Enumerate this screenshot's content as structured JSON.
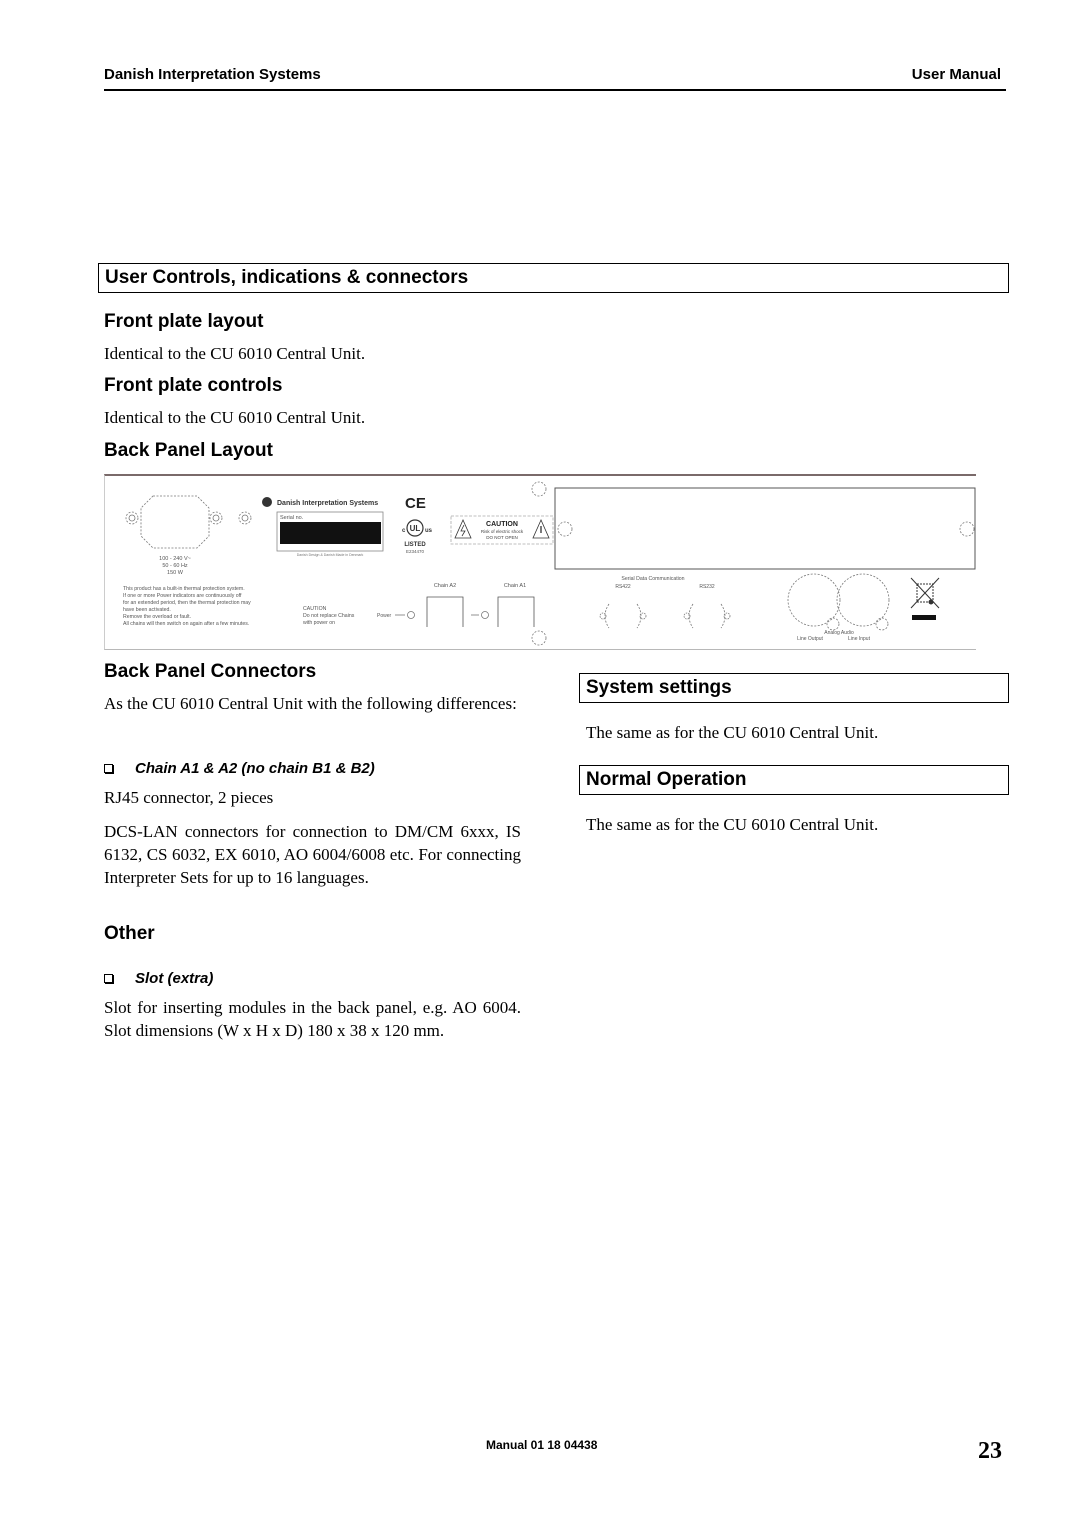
{
  "header": {
    "company": "Danish Interpretation Systems",
    "doc_type": "User Manual"
  },
  "section_title": "User Controls, indications & connectors",
  "left_column": {
    "front_plate_layout": {
      "heading": "Front plate layout",
      "text": "Identical to the CU 6010 Central Unit."
    },
    "front_plate_controls": {
      "heading": "Front plate controls",
      "text": "Identical to the CU 6010 Central Unit."
    },
    "back_panel_layout": {
      "heading": "Back Panel Layout"
    },
    "back_panel_connectors": {
      "heading": "Back Panel Connectors",
      "intro": "As the CU 6010 Central Unit with the following differences:",
      "bullet": "Chain A1 & A2 (no chain B1 & B2)",
      "bullet_text1": "RJ45 connector, 2 pieces",
      "bullet_text2": "DCS-LAN connectors for connection to DM/CM 6xxx, IS 6132, CS 6032, EX 6010, AO 6004/6008 etc. For connecting Interpreter Sets for up to 16 languages."
    },
    "other": {
      "heading": "Other",
      "bullet": "Slot (extra)",
      "text": "Slot for inserting modules in the back panel, e.g. AO 6004. Slot dimensions (W x H x D) 180 x 38 x 120 mm."
    }
  },
  "right_column": {
    "system_settings": {
      "heading": "System settings",
      "text": "The same as for the CU 6010 Central Unit."
    },
    "normal_operation": {
      "heading": "Normal Operation",
      "text": "The same as for the CU 6010 Central Unit."
    }
  },
  "back_panel_figure": {
    "brand": "Danish Interpretation Systems",
    "serial_label": "Serial no.",
    "serial_caption": "Danish Design & Danish Made in Denmark",
    "ce_mark": "CE",
    "ul_listed": "LISTED",
    "ul_number": "E234470",
    "ul_left": "c",
    "ul_right": "us",
    "caution_title": "CAUTION",
    "caution_line1": "Risk of electric shock",
    "caution_line2": "DO NOT OPEN",
    "power_rating": [
      "100 - 240 V~",
      "50 - 60 Hz",
      "150 W"
    ],
    "thermal_notice": [
      "This product has a built-in thermal protection system.",
      "If one or more Power indicators are continuously off",
      "for an extended period, then the thermal protection may",
      "have been activated.",
      "Remove the overload or fault.",
      "All chains will then switch on again after a few minutes."
    ],
    "chain_caution": [
      "CAUTION",
      "Do not replace Chains",
      "with power on"
    ],
    "power_label": "Power",
    "chain_a2": "Chain A2",
    "chain_a1": "Chain A1",
    "serial_data": "Serial Data Communication",
    "rs422": "RS422",
    "rs232": "RS232",
    "analog_audio": "Analog Audio",
    "line_output": "Line Output",
    "line_input": "Line Input"
  },
  "footer": {
    "doc_number": "Manual 01 18 04438",
    "page_number": "23"
  }
}
